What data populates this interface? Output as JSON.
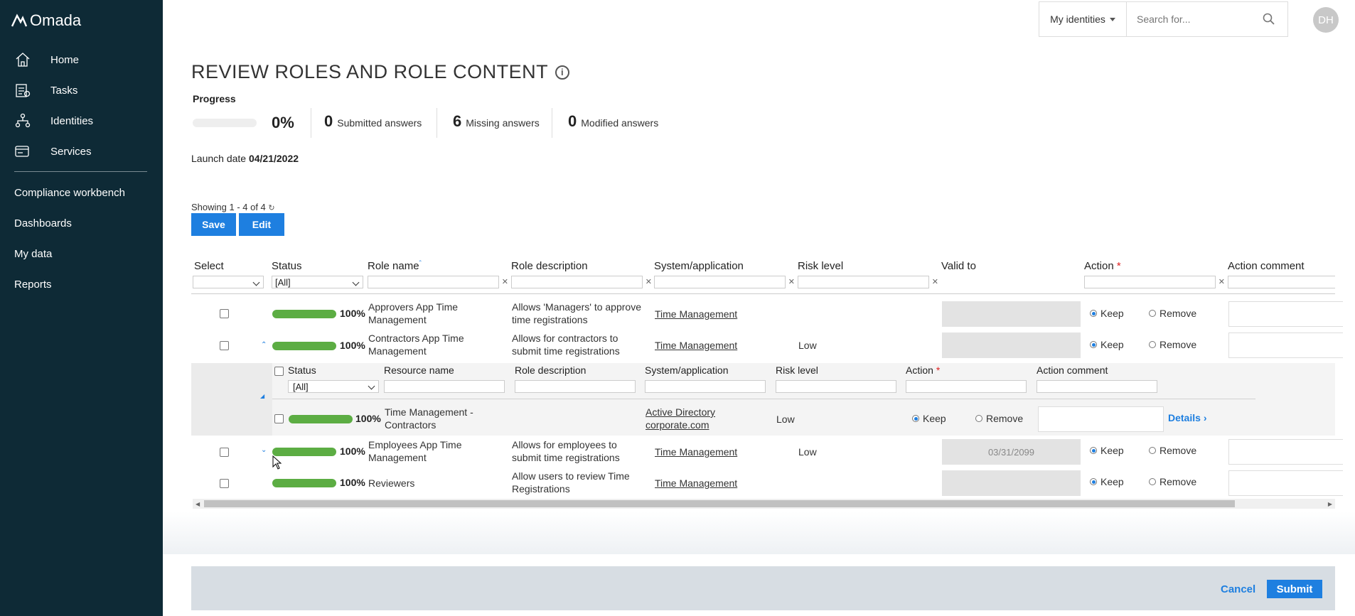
{
  "app": {
    "logo_text": "Omada"
  },
  "sidebar": {
    "items": [
      {
        "label": "Home",
        "icon": "home-icon"
      },
      {
        "label": "Tasks",
        "icon": "tasks-icon"
      },
      {
        "label": "Identities",
        "icon": "identities-icon"
      },
      {
        "label": "Services",
        "icon": "services-icon"
      },
      {
        "label": "Compliance workbench"
      },
      {
        "label": "Dashboards"
      },
      {
        "label": "My data"
      },
      {
        "label": "Reports"
      }
    ]
  },
  "topbar": {
    "identity_selector": "My identities",
    "search_placeholder": "Search for...",
    "avatar_initials": "DH"
  },
  "page": {
    "title": "REVIEW ROLES AND ROLE CONTENT",
    "progress_label": "Progress",
    "progress_percent": "0%",
    "progress_fraction": 0,
    "stats": [
      {
        "value": "0",
        "label": "Submitted answers"
      },
      {
        "value": "6",
        "label": "Missing answers"
      },
      {
        "value": "0",
        "label": "Modified answers"
      }
    ],
    "launch_label": "Launch date",
    "launch_date": "04/21/2022",
    "showing": "Showing 1 - 4 of 4",
    "save_label": "Save",
    "edit_label": "Edit"
  },
  "table": {
    "headers": [
      "Select",
      "Status",
      "Role name",
      "Role description",
      "System/application",
      "Risk level",
      "Valid to",
      "Action",
      "Action comment"
    ],
    "status_filter": "[All]",
    "rows": [
      {
        "status": "100%",
        "role_name": "Approvers App Time Management",
        "description": "Allows 'Managers' to approve time registrations",
        "system": "Time Management",
        "risk": "",
        "valid_to": "",
        "action": "Keep"
      },
      {
        "status": "100%",
        "role_name": "Contractors App Time Management",
        "description": "Allows for contractors to submit time registrations",
        "system": "Time Management",
        "risk": "Low",
        "valid_to": "",
        "action": "Keep"
      },
      {
        "status": "100%",
        "role_name": "Employees App Time Management",
        "description": "Allows for employees to submit time registrations",
        "system": "Time Management",
        "risk": "Low",
        "valid_to": "03/31/2099",
        "action": "Keep"
      },
      {
        "status": "100%",
        "role_name": "Reviewers",
        "description": "Allow users to review Time Registrations",
        "system": "Time Management",
        "risk": "",
        "valid_to": "",
        "action": "Keep"
      }
    ],
    "keep_label": "Keep",
    "remove_label": "Remove"
  },
  "nested": {
    "headers": [
      "Status",
      "Resource name",
      "Role description",
      "System/application",
      "Risk level",
      "Action",
      "Action comment"
    ],
    "status_filter": "[All]",
    "row": {
      "status": "100%",
      "resource_name": "Time Management - Contractors",
      "system": "Active Directory corporate.com",
      "risk": "Low",
      "action": "Keep"
    },
    "details_label": "Details"
  },
  "footer": {
    "cancel_label": "Cancel",
    "submit_label": "Submit"
  },
  "colors": {
    "sidebar": "#0e2a36",
    "accent": "#1e7fe0",
    "progress_green": "#5cad43"
  }
}
